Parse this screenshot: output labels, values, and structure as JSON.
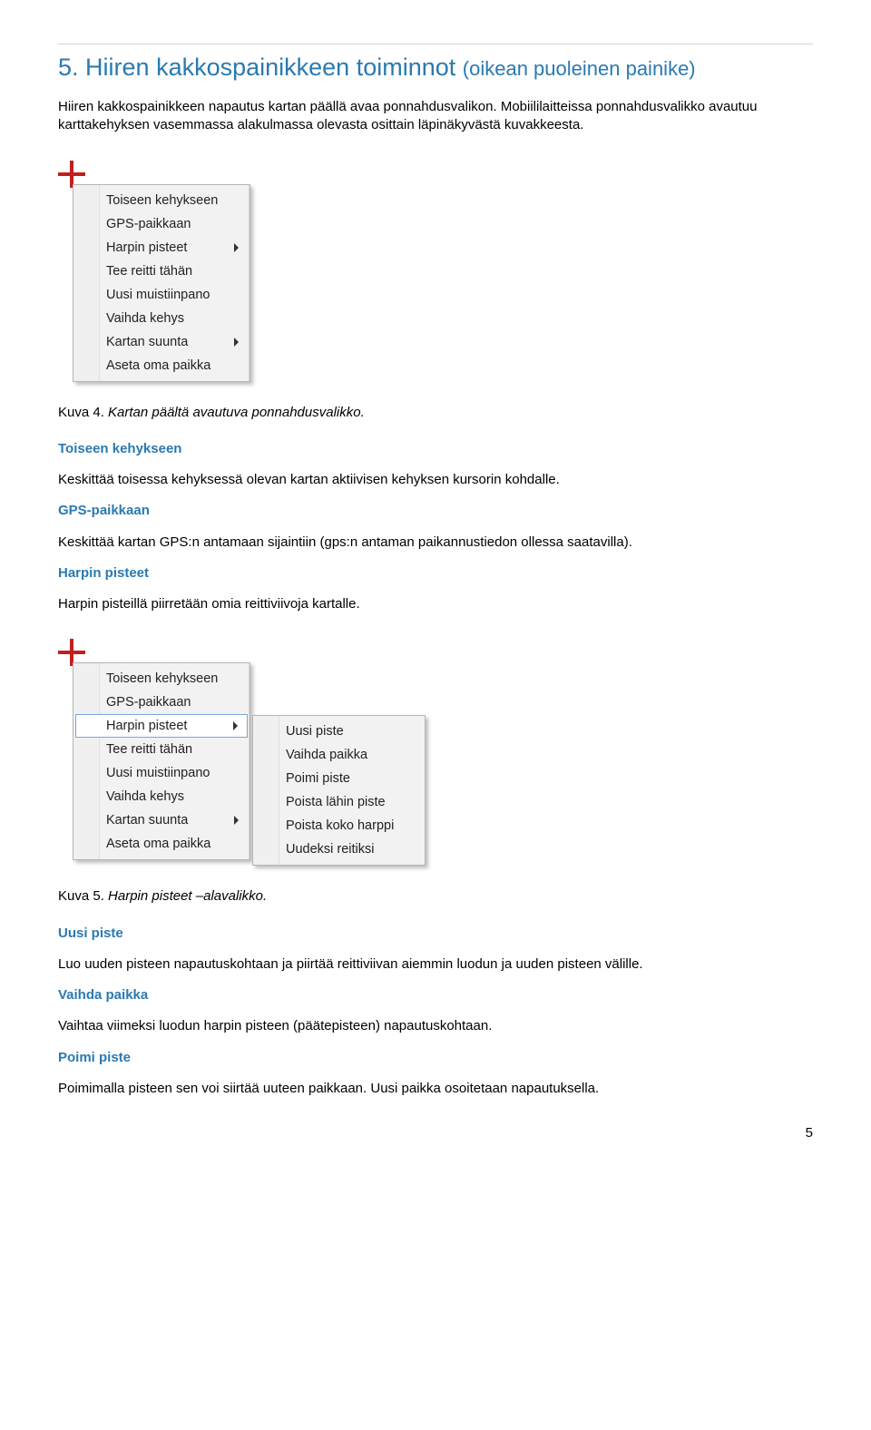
{
  "heading": {
    "number": "5.",
    "main": "Hiiren kakkospainikkeen toiminnot",
    "sub": "(oikean puoleinen painike)"
  },
  "intro": "Hiiren kakkospainikkeen napautus kartan päällä avaa ponnahdusvalikon. Mobiililaitteissa ponnahdusvalikko avautuu karttakehyksen vasemmassa alakulmassa olevasta osittain läpinäkyvästä kuvakkeesta.",
  "menu1": {
    "items": [
      {
        "label": "Toiseen kehykseen",
        "hasSubmenu": false
      },
      {
        "label": "GPS-paikkaan",
        "hasSubmenu": false
      },
      {
        "label": "Harpin pisteet",
        "hasSubmenu": true
      },
      {
        "label": "Tee reitti tähän",
        "hasSubmenu": false
      },
      {
        "label": "Uusi muistiinpano",
        "hasSubmenu": false
      },
      {
        "label": "Vaihda kehys",
        "hasSubmenu": false
      },
      {
        "label": "Kartan suunta",
        "hasSubmenu": true
      },
      {
        "label": "Aseta oma paikka",
        "hasSubmenu": false
      }
    ]
  },
  "caption1": {
    "label": "Kuva 4.",
    "title": "Kartan päältä avautuva ponnahdusvalikko."
  },
  "defs1": [
    {
      "term": "Toiseen kehykseen",
      "body": "Keskittää toisessa kehyksessä olevan kartan aktiivisen kehyksen kursorin kohdalle."
    },
    {
      "term": "GPS-paikkaan",
      "body": "Keskittää kartan GPS:n antamaan sijaintiin (gps:n antaman paikannustiedon ollessa saatavilla)."
    },
    {
      "term": "Harpin pisteet",
      "body": "Harpin pisteillä piirretään omia reittiviivoja kartalle."
    }
  ],
  "menu2": {
    "items": [
      {
        "label": "Toiseen kehykseen",
        "hasSubmenu": false,
        "highlight": false
      },
      {
        "label": "GPS-paikkaan",
        "hasSubmenu": false,
        "highlight": false
      },
      {
        "label": "Harpin pisteet",
        "hasSubmenu": true,
        "highlight": true
      },
      {
        "label": "Tee reitti tähän",
        "hasSubmenu": false,
        "highlight": false
      },
      {
        "label": "Uusi muistiinpano",
        "hasSubmenu": false,
        "highlight": false
      },
      {
        "label": "Vaihda kehys",
        "hasSubmenu": false,
        "highlight": false
      },
      {
        "label": "Kartan suunta",
        "hasSubmenu": true,
        "highlight": false
      },
      {
        "label": "Aseta oma paikka",
        "hasSubmenu": false,
        "highlight": false
      }
    ],
    "submenu": [
      "Uusi piste",
      "Vaihda paikka",
      "Poimi piste",
      "Poista lähin piste",
      "Poista koko harppi",
      "Uudeksi reitiksi"
    ]
  },
  "caption2": {
    "label": "Kuva 5.",
    "title": "Harpin pisteet –alavalikko."
  },
  "defs2": [
    {
      "term": "Uusi piste",
      "body": "Luo uuden pisteen napautuskohtaan ja piirtää reittiviivan aiemmin luodun ja uuden pisteen välille."
    },
    {
      "term": "Vaihda paikka",
      "body": "Vaihtaa viimeksi luodun harpin pisteen (päätepisteen) napautuskohtaan."
    },
    {
      "term": "Poimi piste",
      "body": "Poimimalla pisteen sen voi siirtää uuteen paikkaan. Uusi paikka osoitetaan napautuksella."
    }
  ],
  "pageNumber": "5"
}
